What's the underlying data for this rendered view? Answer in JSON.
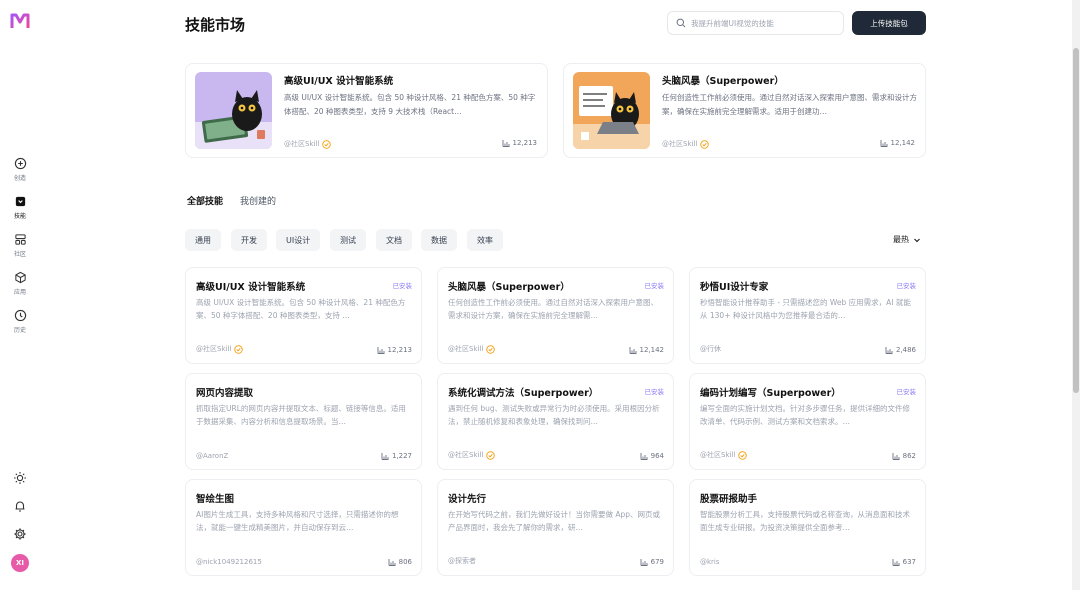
{
  "colors": {
    "accent": "#8b7cf6",
    "dark_button": "#1f2937",
    "avatar": "#e75aa8",
    "verified": "#f59e0b"
  },
  "sidebar": {
    "logo_icon": "m-logo-icon",
    "items": [
      {
        "label": "创造",
        "icon": "plus-circle-icon"
      },
      {
        "label": "技能",
        "icon": "briefcase-icon"
      },
      {
        "label": "社区",
        "icon": "grid-icon"
      },
      {
        "label": "应用",
        "icon": "cube-icon"
      },
      {
        "label": "历史",
        "icon": "clock-icon"
      }
    ],
    "avatar_initials": "XI"
  },
  "header": {
    "title": "技能市场",
    "search_placeholder": "我提升前端UI视觉的技能",
    "upload_label": "上传技能包"
  },
  "featured": [
    {
      "title": "高级UI/UX 设计智能系统",
      "desc": "高级 UI/UX 设计智能系统。包含 50 种设计风格、21 种配色方案、50 种字体搭配、20 种图表类型，支持 9 大技术栈（React…",
      "author": "@社区Skill",
      "count": "12,213"
    },
    {
      "title": "头脑风暴（Superpower）",
      "desc": "任何创造性工作前必须使用。通过自然对话深入探索用户意图、需求和设计方案，确保在实施前完全理解需求。适用于创建功…",
      "author": "@社区Skill",
      "count": "12,142"
    }
  ],
  "tabs": [
    "全部技能",
    "我创建的"
  ],
  "categories": [
    "通用",
    "开发",
    "UI设计",
    "测试",
    "文档",
    "数据",
    "效率"
  ],
  "sort_label": "最热",
  "skills": [
    {
      "title": "高级UI/UX 设计智能系统",
      "badge": "已安装",
      "desc": "高级 UI/UX 设计智能系统。包含 50 种设计风格、21 种配色方案、50 种字体搭配、20 种图表类型，支持 …",
      "author": "@社区Skill",
      "verified": true,
      "count": "12,213"
    },
    {
      "title": "头脑风暴（Superpower）",
      "badge": "已安装",
      "desc": "任何创造性工作前必须使用。通过自然对话深入探索用户意图、需求和设计方案，确保在实施前完全理解需…",
      "author": "@社区Skill",
      "verified": true,
      "count": "12,142"
    },
    {
      "title": "秒悟UI设计专家",
      "badge": "已安装",
      "desc": "秒悟智能设计推荐助手 - 只需描述您的 Web 应用需求，AI 就能从 130+ 种设计风格中为您推荐最合适的…",
      "author": "@行休",
      "verified": false,
      "count": "2,486"
    },
    {
      "title": "网页内容提取",
      "badge": "",
      "desc": "抓取指定URL的网页内容并提取文本、标题、链接等信息。适用于数据采集、内容分析和信息提取场景。当…",
      "author": "@AaronZ",
      "verified": false,
      "count": "1,227"
    },
    {
      "title": "系统化调试方法（Superpower）",
      "badge": "已安装",
      "desc": "遇到任何 bug、测试失败或异常行为时必须使用。采用根因分析法，禁止随机修复和表象处理，确保找到问…",
      "author": "@社区Skill",
      "verified": true,
      "count": "964"
    },
    {
      "title": "编码计划编写（Superpower）",
      "badge": "已安装",
      "desc": "编写全面的实施计划文档。针对多步骤任务，提供详细的文件修改清单、代码示例、测试方案和文档索求。…",
      "author": "@社区Skill",
      "verified": true,
      "count": "862"
    },
    {
      "title": "智绘生图",
      "badge": "",
      "desc": "AI图片生成工具，支持多种风格和尺寸选择，只需描述你的想法，就能一键生成精美图片，并自动保存到云…",
      "author": "@nick1049212615",
      "verified": false,
      "count": "806"
    },
    {
      "title": "设计先行",
      "badge": "",
      "desc": "在开始写代码之前，我们先做好设计！当你需要做 App、网页或产品界面时，我会先了解你的需求，研…",
      "author": "@探索者",
      "verified": false,
      "count": "679"
    },
    {
      "title": "股票研报助手",
      "badge": "",
      "desc": "智能股票分析工具，支持股票代码或名称查询，从消息面和技术面生成专业研报。为投资决策提供全面参考…",
      "author": "@kris",
      "verified": false,
      "count": "637"
    }
  ]
}
